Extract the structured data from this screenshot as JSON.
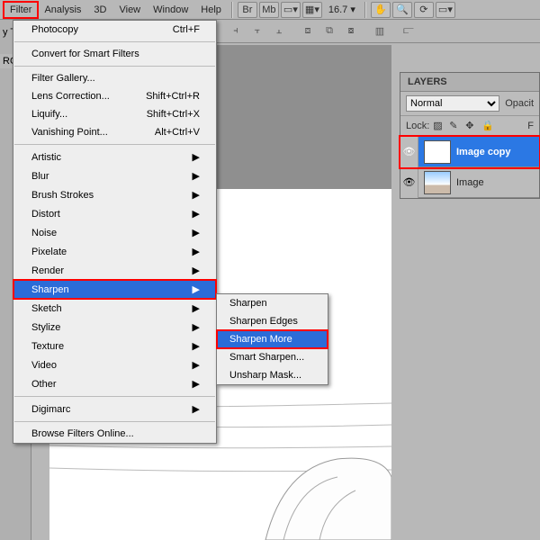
{
  "menubar": {
    "items": [
      "Filter",
      "Analysis",
      "3D",
      "View",
      "Window",
      "Help"
    ],
    "active": "Filter",
    "zoom": "16.7",
    "icons": [
      "Br",
      "Mb"
    ]
  },
  "filter_menu": {
    "groups": [
      [
        {
          "label": "Photocopy",
          "shortcut": "Ctrl+F",
          "submenu": false
        }
      ],
      [
        {
          "label": "Convert for Smart Filters",
          "shortcut": "",
          "submenu": false
        }
      ],
      [
        {
          "label": "Filter Gallery...",
          "shortcut": "",
          "submenu": false
        },
        {
          "label": "Lens Correction...",
          "shortcut": "Shift+Ctrl+R",
          "submenu": false
        },
        {
          "label": "Liquify...",
          "shortcut": "Shift+Ctrl+X",
          "submenu": false
        },
        {
          "label": "Vanishing Point...",
          "shortcut": "Alt+Ctrl+V",
          "submenu": false
        }
      ],
      [
        {
          "label": "Artistic",
          "submenu": true
        },
        {
          "label": "Blur",
          "submenu": true
        },
        {
          "label": "Brush Strokes",
          "submenu": true
        },
        {
          "label": "Distort",
          "submenu": true
        },
        {
          "label": "Noise",
          "submenu": true
        },
        {
          "label": "Pixelate",
          "submenu": true
        },
        {
          "label": "Render",
          "submenu": true
        },
        {
          "label": "Sharpen",
          "submenu": true,
          "highlighted": true
        },
        {
          "label": "Sketch",
          "submenu": true
        },
        {
          "label": "Stylize",
          "submenu": true
        },
        {
          "label": "Texture",
          "submenu": true
        },
        {
          "label": "Video",
          "submenu": true
        },
        {
          "label": "Other",
          "submenu": true
        }
      ],
      [
        {
          "label": "Digimarc",
          "submenu": true
        }
      ],
      [
        {
          "label": "Browse Filters Online...",
          "submenu": false
        }
      ]
    ]
  },
  "sharpen_submenu": {
    "items": [
      {
        "label": "Sharpen"
      },
      {
        "label": "Sharpen Edges"
      },
      {
        "label": "Sharpen More",
        "highlighted": true
      },
      {
        "label": "Smart Sharpen..."
      },
      {
        "label": "Unsharp Mask..."
      }
    ]
  },
  "layers_panel": {
    "title": "LAYERS",
    "mode": "Normal",
    "opacity_label": "Opacit",
    "lock_label": "Lock:",
    "fill_label": "F",
    "layers": [
      {
        "name": "Image copy",
        "selected": true
      },
      {
        "name": "Image",
        "selected": false
      }
    ]
  },
  "doc_tag": "RG",
  "toolbar_suffix_label": "y T"
}
